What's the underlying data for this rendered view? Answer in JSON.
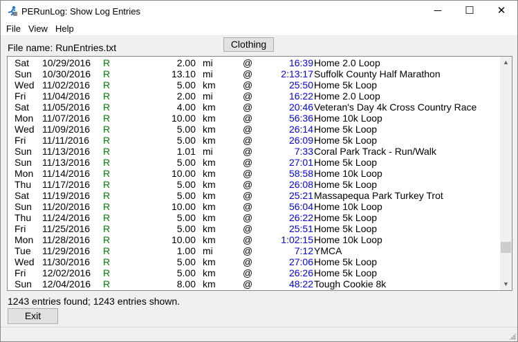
{
  "window": {
    "title": "PERunLog: Show Log Entries",
    "minimize": "─",
    "maximize": "☐",
    "close": "✕"
  },
  "menu": [
    "File",
    "View",
    "Help"
  ],
  "file_label": "File name: RunEntries.txt",
  "clothing_label": "Clothing",
  "exit_label": "Exit",
  "status": "1243 entries found; 1243 entries shown.",
  "scroll_position": 0.87,
  "entries": [
    [
      "Sat",
      "10/29/2016",
      "R",
      "2.00",
      "mi",
      "@",
      "16:39",
      "Home 2.0 Loop"
    ],
    [
      "Sun",
      "10/30/2016",
      "R",
      "13.10",
      "mi",
      "@",
      "2:13:17",
      "Suffolk County Half Marathon"
    ],
    [
      "Wed",
      "11/02/2016",
      "R",
      "5.00",
      "km",
      "@",
      "25:50",
      "Home 5k Loop"
    ],
    [
      "Fri",
      "11/04/2016",
      "R",
      "2.00",
      "mi",
      "@",
      "16:22",
      "Home 2.0 Loop"
    ],
    [
      "Sat",
      "11/05/2016",
      "R",
      "4.00",
      "km",
      "@",
      "20:46",
      "Veteran's Day 4k Cross Country Race"
    ],
    [
      "Mon",
      "11/07/2016",
      "R",
      "10.00",
      "km",
      "@",
      "56:36",
      "Home 10k Loop"
    ],
    [
      "Wed",
      "11/09/2016",
      "R",
      "5.00",
      "km",
      "@",
      "26:14",
      "Home 5k Loop"
    ],
    [
      "Fri",
      "11/11/2016",
      "R",
      "5.00",
      "km",
      "@",
      "26:09",
      "Home 5k Loop"
    ],
    [
      "Sun",
      "11/13/2016",
      "R",
      "1.01",
      "mi",
      "@",
      "7:33",
      "Coral Park Track - Run/Walk"
    ],
    [
      "Sun",
      "11/13/2016",
      "R",
      "5.00",
      "km",
      "@",
      "27:01",
      "Home 5k Loop"
    ],
    [
      "Mon",
      "11/14/2016",
      "R",
      "10.00",
      "km",
      "@",
      "58:58",
      "Home 10k Loop"
    ],
    [
      "Thu",
      "11/17/2016",
      "R",
      "5.00",
      "km",
      "@",
      "26:08",
      "Home 5k Loop"
    ],
    [
      "Sat",
      "11/19/2016",
      "R",
      "5.00",
      "km",
      "@",
      "25:21",
      "Massapequa Park Turkey Trot"
    ],
    [
      "Sun",
      "11/20/2016",
      "R",
      "10.00",
      "km",
      "@",
      "56:04",
      "Home 10k Loop"
    ],
    [
      "Thu",
      "11/24/2016",
      "R",
      "5.00",
      "km",
      "@",
      "26:22",
      "Home 5k Loop"
    ],
    [
      "Fri",
      "11/25/2016",
      "R",
      "5.00",
      "km",
      "@",
      "25:51",
      "Home 5k Loop"
    ],
    [
      "Mon",
      "11/28/2016",
      "R",
      "10.00",
      "km",
      "@",
      "1:02:15",
      "Home 10k Loop"
    ],
    [
      "Tue",
      "11/29/2016",
      "R",
      "1.00",
      "mi",
      "@",
      "7:12",
      "YMCA"
    ],
    [
      "Wed",
      "11/30/2016",
      "R",
      "5.00",
      "km",
      "@",
      "27:06",
      "Home 5k Loop"
    ],
    [
      "Fri",
      "12/02/2016",
      "R",
      "5.00",
      "km",
      "@",
      "26:26",
      "Home 5k Loop"
    ],
    [
      "Sun",
      "12/04/2016",
      "R",
      "8.00",
      "km",
      "@",
      "48:22",
      "Tough Cookie 8k"
    ]
  ]
}
